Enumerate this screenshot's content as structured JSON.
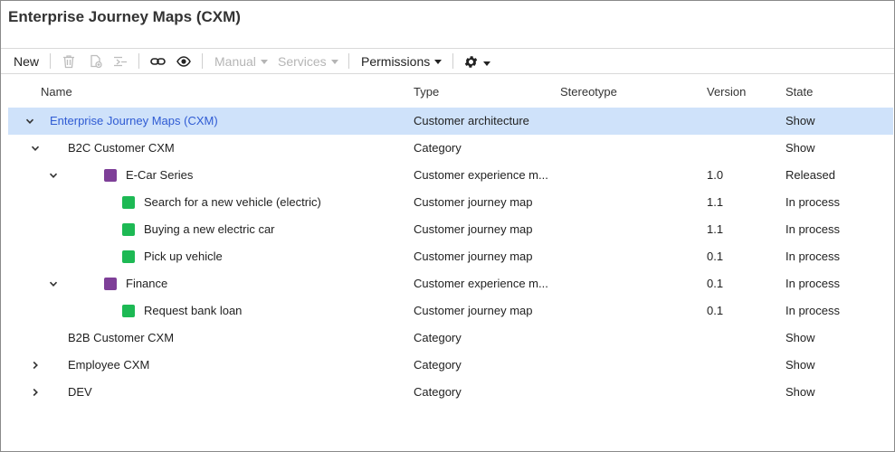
{
  "page": {
    "title": "Enterprise Journey Maps (CXM)"
  },
  "toolbar": {
    "new_label": "New",
    "manual_label": "Manual",
    "services_label": "Services",
    "permissions_label": "Permissions"
  },
  "columns": {
    "name": "Name",
    "type": "Type",
    "stereotype": "Stereotype",
    "version": "Version",
    "state": "State"
  },
  "colors": {
    "selection": "#cfe2fa",
    "link": "#2f5bd3",
    "purple": "#7e3f98",
    "green": "#1db954"
  },
  "rows": [
    {
      "name": "Enterprise Journey Maps (CXM)",
      "type": "Customer architecture",
      "stereotype": "",
      "version": "",
      "state": "Show",
      "level": 0,
      "toggle": "expanded",
      "icon": "",
      "selected": true
    },
    {
      "name": "B2C Customer CXM",
      "type": "Category",
      "stereotype": "",
      "version": "",
      "state": "Show",
      "level": 1,
      "toggle": "expanded",
      "icon": ""
    },
    {
      "name": "E-Car Series",
      "type": "Customer experience m...",
      "stereotype": "",
      "version": "1.0",
      "state": "Released",
      "level": 2,
      "toggle": "expanded",
      "icon": "purple"
    },
    {
      "name": "Search for a new vehicle (electric)",
      "type": "Customer journey map",
      "stereotype": "",
      "version": "1.1",
      "state": "In process",
      "level": 3,
      "toggle": "",
      "icon": "green"
    },
    {
      "name": "Buying a new electric car",
      "type": "Customer journey map",
      "stereotype": "",
      "version": "1.1",
      "state": "In process",
      "level": 3,
      "toggle": "",
      "icon": "green"
    },
    {
      "name": "Pick up vehicle",
      "type": "Customer journey map",
      "stereotype": "",
      "version": "0.1",
      "state": "In process",
      "level": 3,
      "toggle": "",
      "icon": "green"
    },
    {
      "name": "Finance",
      "type": "Customer experience m...",
      "stereotype": "",
      "version": "0.1",
      "state": "In process",
      "level": 2,
      "toggle": "expanded",
      "icon": "purple"
    },
    {
      "name": "Request bank loan",
      "type": "Customer journey map",
      "stereotype": "",
      "version": "0.1",
      "state": "In process",
      "level": 3,
      "toggle": "",
      "icon": "green"
    },
    {
      "name": "B2B Customer CXM",
      "type": "Category",
      "stereotype": "",
      "version": "",
      "state": "Show",
      "level": 1,
      "toggle": "",
      "icon": ""
    },
    {
      "name": "Employee CXM",
      "type": "Category",
      "stereotype": "",
      "version": "",
      "state": "Show",
      "level": 1,
      "toggle": "collapsed",
      "icon": ""
    },
    {
      "name": "DEV",
      "type": "Category",
      "stereotype": "",
      "version": "",
      "state": "Show",
      "level": 1,
      "toggle": "collapsed",
      "icon": ""
    }
  ]
}
